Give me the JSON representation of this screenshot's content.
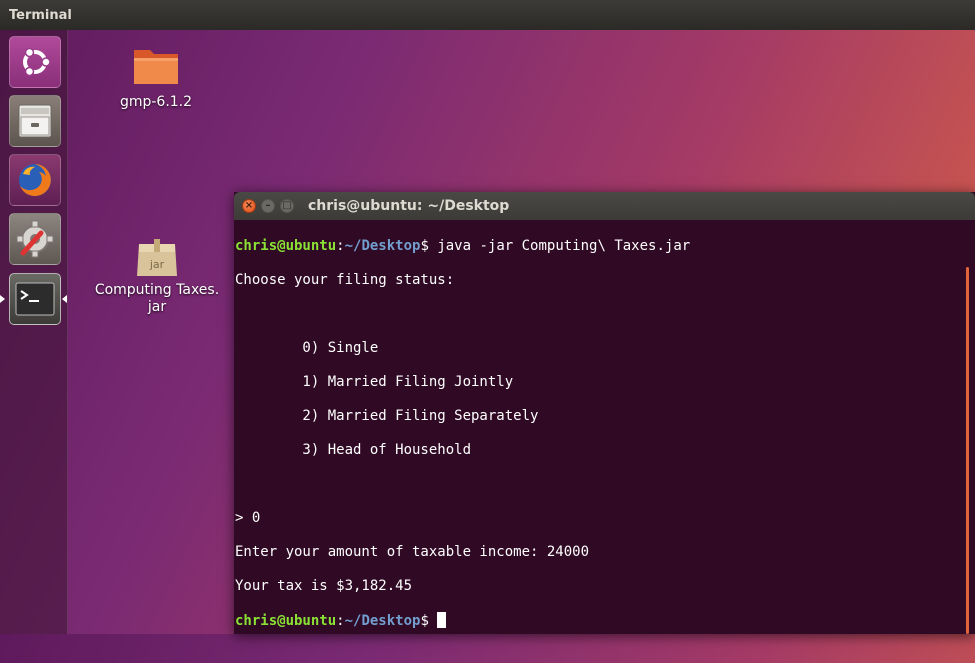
{
  "top_panel": {
    "title": "Terminal"
  },
  "launcher": {
    "items": [
      {
        "name": "dash-home",
        "icon": "ubuntu-logo-icon"
      },
      {
        "name": "files",
        "icon": "file-cabinet-icon"
      },
      {
        "name": "firefox",
        "icon": "firefox-icon"
      },
      {
        "name": "system-settings",
        "icon": "settings-wrench-icon"
      },
      {
        "name": "terminal",
        "icon": "terminal-icon",
        "active": true
      }
    ]
  },
  "desktop": {
    "icons": [
      {
        "label": "gmp-6.1.2",
        "icon": "folder-icon"
      },
      {
        "label_line1": "Computing Taxes.",
        "label_line2": "jar",
        "badge": "jar",
        "icon": "package-icon"
      }
    ]
  },
  "terminal": {
    "title": "chris@ubuntu: ~/Desktop",
    "prompt_user": "chris@ubuntu",
    "prompt_sep": ":",
    "prompt_path": "~/Desktop",
    "prompt_symbol": "$",
    "command": " java -jar Computing\\ Taxes.jar",
    "lines": {
      "choose": "Choose your filing status:",
      "opt0": "        0) Single",
      "opt1": "        1) Married Filing Jointly",
      "opt2": "        2) Married Filing Separately",
      "opt3": "        3) Head of Household",
      "input": "> 0",
      "income": "Enter your amount of taxable income: 24000",
      "result": "Your tax is $3,182.45"
    }
  },
  "colors": {
    "prompt_user": "#8ae234",
    "prompt_path": "#729fcf",
    "terminal_bg": "#300a24",
    "close_button": "#df4a16"
  }
}
